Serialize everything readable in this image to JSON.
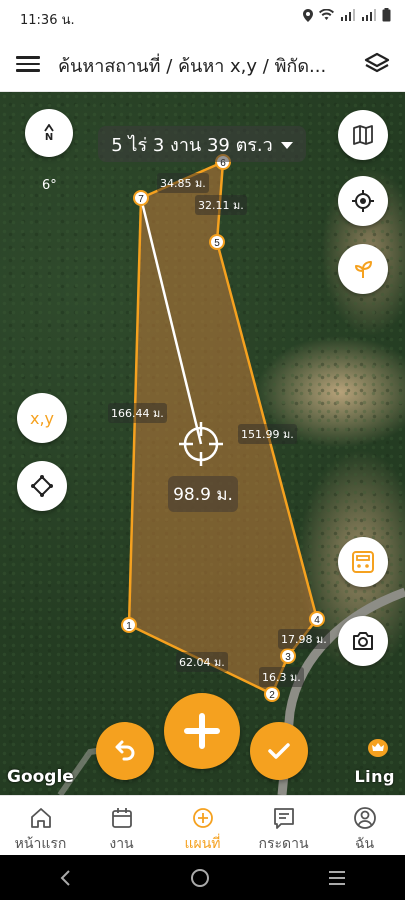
{
  "status_bar": {
    "time": "11:36 น."
  },
  "header": {
    "title": "ค้นหาสถานที่ / ค้นหา x,y / พิกัด..."
  },
  "map": {
    "area_label": "5 ไร่ 3 งาน 39 ตร.ว",
    "heading": "6°",
    "compass_letter": "N",
    "xy_label": "x,y",
    "distance_label": "98.9 ม.",
    "edge_labels": [
      "34.85 ม.",
      "32.11 ม.",
      "166.44 ม.",
      "151.99 ม.",
      "17.98 ม.",
      "16.3 ม.",
      "62.04 ม."
    ],
    "vertices": [
      "1",
      "2",
      "3",
      "4",
      "5",
      "6",
      "7"
    ],
    "google_label": "Google",
    "provider_label": "Ling"
  },
  "colors": {
    "accent": "#f5a11f",
    "polygon_fill": "#c07a3a"
  },
  "bottom_nav": {
    "items": [
      {
        "label": "หน้าแรก",
        "icon": "home-icon"
      },
      {
        "label": "งาน",
        "icon": "calendar-icon"
      },
      {
        "label": "แผนที่",
        "icon": "map-plus-icon",
        "active": true
      },
      {
        "label": "กระดาน",
        "icon": "board-icon"
      },
      {
        "label": "ฉัน",
        "icon": "profile-icon"
      }
    ]
  }
}
